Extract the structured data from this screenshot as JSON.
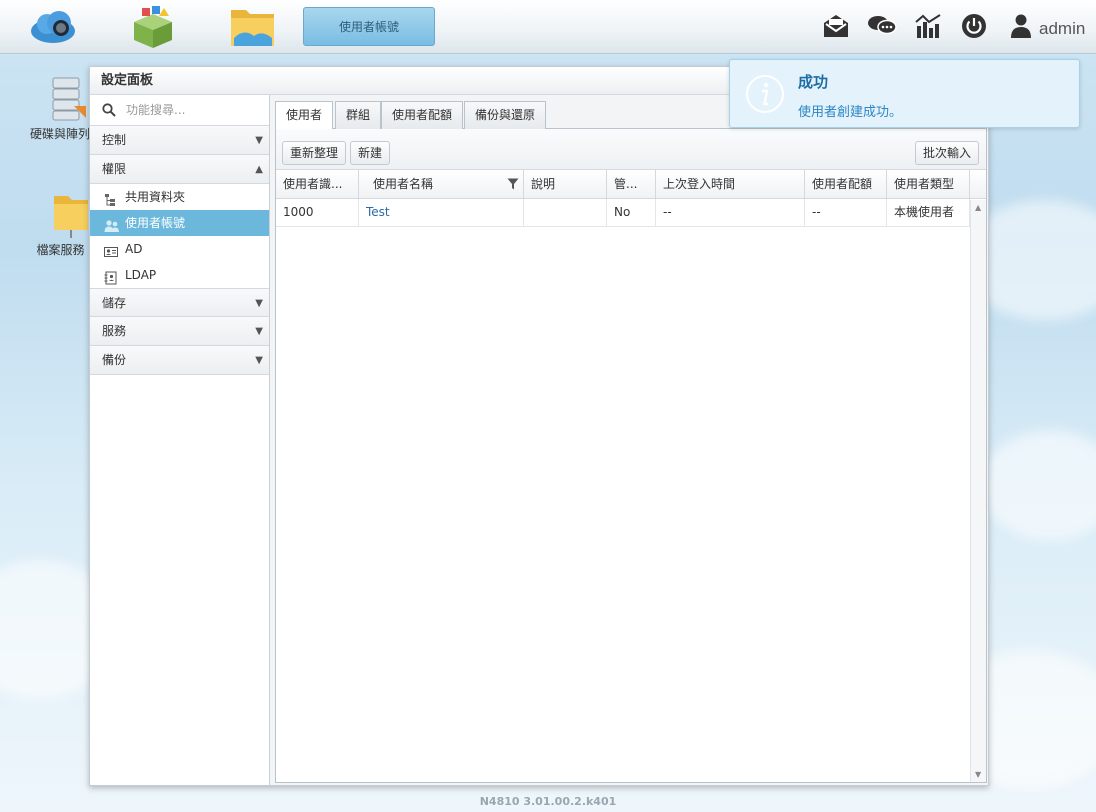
{
  "taskbar": {
    "active_task_label": "使用者帳號",
    "user_name": "admin"
  },
  "desktop": {
    "items": [
      {
        "label": "硬碟與陣列"
      },
      {
        "label": "檔案服務"
      }
    ]
  },
  "window": {
    "title": "設定面板",
    "search_placeholder": "功能搜尋...",
    "sections": [
      {
        "label": "控制",
        "expanded": false
      },
      {
        "label": "權限",
        "expanded": true,
        "items": [
          {
            "label": "共用資料夾"
          },
          {
            "label": "使用者帳號",
            "active": true
          },
          {
            "label": "AD"
          },
          {
            "label": "LDAP"
          }
        ]
      },
      {
        "label": "儲存",
        "expanded": false
      },
      {
        "label": "服務",
        "expanded": false
      },
      {
        "label": "備份",
        "expanded": false
      }
    ],
    "tabs": [
      "使用者",
      "群組",
      "使用者配額",
      "備份與還原"
    ],
    "toolbar": {
      "refresh_label": "重新整理",
      "new_label": "新建",
      "batch_label": "批次輸入"
    },
    "columns": [
      "使用者識...",
      "使用者名稱",
      "說明",
      "管...",
      "上次登入時間",
      "使用者配額",
      "使用者類型"
    ],
    "rows": [
      [
        "1000",
        "Test",
        "",
        "No",
        "--",
        "--",
        "本機使用者"
      ]
    ]
  },
  "notification": {
    "title": "成功",
    "message": "使用者創建成功。"
  },
  "footer": {
    "version": "N4810   3.01.00.2.k401"
  },
  "colors": {
    "accent": "#6bb8dc",
    "link": "#2a6aa8",
    "toast_title": "#1d6ea5"
  }
}
